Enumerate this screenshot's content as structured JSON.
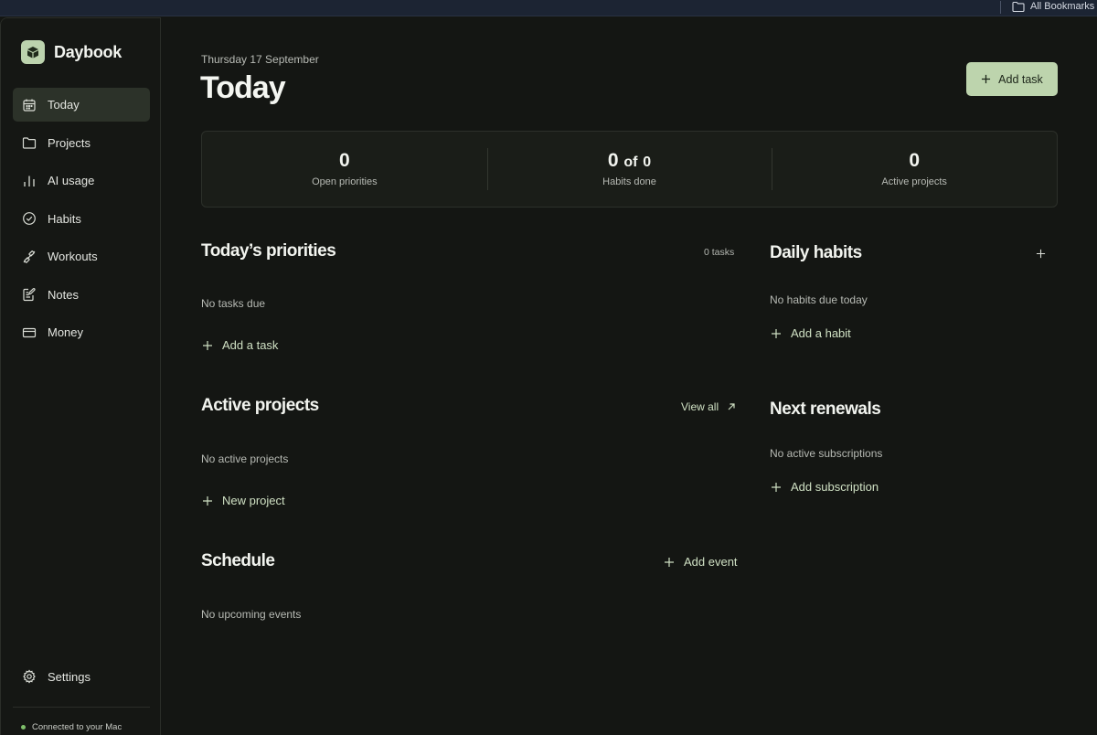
{
  "browser": {
    "bookmarks_label": "All Bookmarks"
  },
  "app": {
    "name": "Daybook",
    "accent_color": "#bdd4ad"
  },
  "sidebar": {
    "items": [
      {
        "label": "Today",
        "icon": "calendar-icon",
        "active": true
      },
      {
        "label": "Projects",
        "icon": "folder-icon"
      },
      {
        "label": "AI usage",
        "icon": "bar-chart-icon"
      },
      {
        "label": "Habits",
        "icon": "check-circle-icon"
      },
      {
        "label": "Workouts",
        "icon": "dumbbell-icon"
      },
      {
        "label": "Notes",
        "icon": "note-icon"
      },
      {
        "label": "Money",
        "icon": "credit-card-icon"
      }
    ],
    "settings_label": "Settings",
    "connection_status": "Connected to your Mac"
  },
  "header": {
    "date": "Thursday 17 September",
    "title": "Today",
    "add_task_label": "Add task"
  },
  "stats": {
    "open_priorities": {
      "value": "0",
      "label": "Open priorities"
    },
    "habits_done": {
      "done": "0",
      "of": "of",
      "total": "0",
      "label": "Habits done"
    },
    "active_projects": {
      "value": "0",
      "label": "Active projects"
    }
  },
  "priorities": {
    "title": "Today’s priorities",
    "count": "0 tasks",
    "empty": "No tasks due",
    "action": "Add a task"
  },
  "habits": {
    "title": "Daily habits",
    "empty": "No habits due today",
    "action": "Add a habit"
  },
  "projects": {
    "title": "Active projects",
    "view_all": "View all",
    "empty": "No active projects",
    "action": "New project"
  },
  "renewals": {
    "title": "Next renewals",
    "empty": "No active subscriptions",
    "action": "Add subscription"
  },
  "schedule": {
    "title": "Schedule",
    "action": "Add event",
    "empty": "No upcoming events"
  }
}
